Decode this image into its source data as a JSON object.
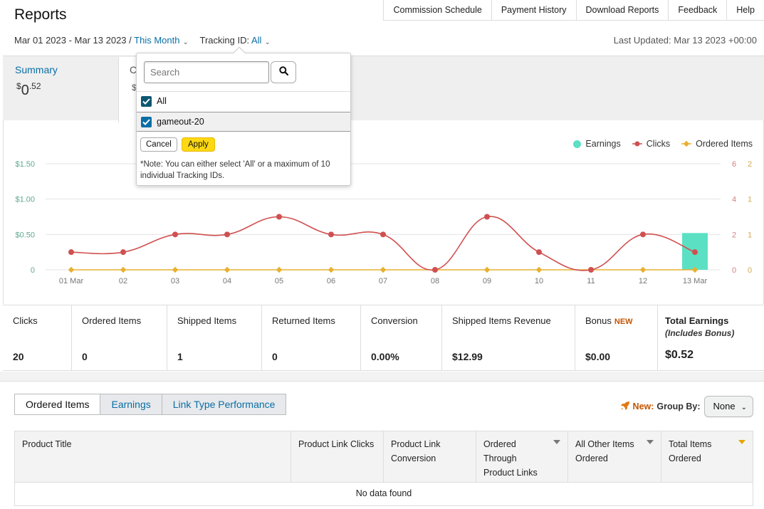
{
  "header": {
    "title": "Reports",
    "nav": [
      "Commission Schedule",
      "Payment History",
      "Download Reports",
      "Feedback",
      "Help"
    ],
    "date_range": "Mar 01 2023 - Mar 13 2023 /",
    "period": "This Month",
    "tracking_label": "Tracking ID:",
    "tracking_value": "All",
    "last_updated": "Last Updated: Mar 13 2023 +00:00"
  },
  "summary": {
    "title": "Summary",
    "currency": "$",
    "whole": "0",
    "cents": ".52",
    "second_card_title": "C",
    "second_card_value": "$"
  },
  "popup": {
    "search_placeholder": "Search",
    "options": [
      {
        "label": "All",
        "checked": true
      },
      {
        "label": "gameout-20",
        "checked": true
      }
    ],
    "cancel_label": "Cancel",
    "apply_label": "Apply",
    "note": "*Note: You can either select 'All' or a maximum of 10 individual Tracking IDs."
  },
  "chart_data": {
    "type": "line",
    "categories": [
      "01 Mar",
      "02",
      "03",
      "04",
      "05",
      "06",
      "07",
      "08",
      "09",
      "10",
      "11",
      "12",
      "13 Mar"
    ],
    "series": [
      {
        "name": "Earnings",
        "kind": "bar",
        "axis": "left",
        "color": "#5ce0c4",
        "values": [
          0,
          0,
          0,
          0,
          0,
          0,
          0,
          0,
          0,
          0,
          0,
          0,
          0.52
        ]
      },
      {
        "name": "Clicks",
        "kind": "line",
        "axis": "right1",
        "color": "#d05050",
        "values": [
          1,
          1,
          2,
          2,
          3,
          2,
          2,
          0,
          3,
          1,
          0,
          2,
          1
        ]
      },
      {
        "name": "Ordered Items",
        "kind": "line",
        "axis": "right2",
        "color": "#e8b030",
        "values": [
          0,
          0,
          0,
          0,
          0,
          0,
          0,
          0,
          0,
          0,
          0,
          0,
          0
        ]
      }
    ],
    "left_ticks": [
      "$1.50",
      "$1.00",
      "$0.50",
      "0"
    ],
    "right1_ticks": [
      "6",
      "4",
      "2",
      "0"
    ],
    "right2_ticks": [
      "2",
      "1",
      "1",
      "0"
    ],
    "ylim_left": [
      0,
      1.5
    ],
    "ylim_right1": [
      0,
      6
    ],
    "ylim_right2": [
      0,
      2
    ],
    "grid": true,
    "legend_position": "top-right"
  },
  "stats": [
    {
      "label": "Clicks",
      "value": "20"
    },
    {
      "label": "Ordered Items",
      "value": "0"
    },
    {
      "label": "Shipped Items",
      "value": "1"
    },
    {
      "label": "Returned Items",
      "value": "0"
    },
    {
      "label": "Conversion",
      "value": "0.00%"
    },
    {
      "label": "Shipped Items Revenue",
      "value": "$12.99"
    },
    {
      "label": "Bonus",
      "value": "$0.00",
      "badge": "NEW"
    },
    {
      "label": "Total Earnings",
      "value": "$0.52",
      "sub": "(Includes Bonus)"
    }
  ],
  "tabs": [
    "Ordered Items",
    "Earnings",
    "Link Type Performance"
  ],
  "groupby": {
    "new_label": "New:",
    "label": "Group By:",
    "value": "None"
  },
  "table": {
    "columns": [
      "Product Title",
      "Product Link Clicks",
      "Product Link Conversion",
      "Ordered Through Product Links",
      "All Other Items Ordered",
      "Total Items Ordered"
    ],
    "empty_text": "No data found"
  },
  "colors": {
    "link": "#0a6ea5",
    "apply": "#ffd814",
    "earnings": "#5ce0c4",
    "clicks": "#d05050",
    "ordered": "#e8b030",
    "new_badge": "#c45500"
  }
}
